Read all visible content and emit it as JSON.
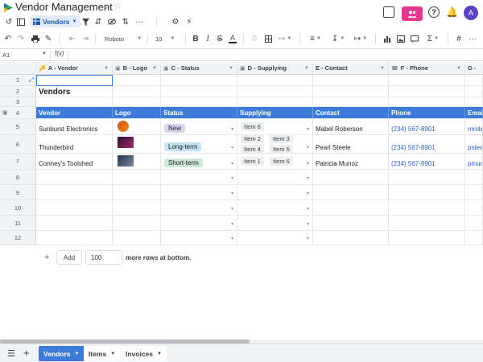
{
  "app": {
    "title": "Vendor Management",
    "avatar_letter": "A",
    "share_color": "#e2388e",
    "accent": "#3d7bd9"
  },
  "view": {
    "label": "Vendors"
  },
  "toolbar": {
    "font": "Roboto",
    "font_size": "10"
  },
  "formula": {
    "cell_ref": "A1",
    "fx_label": "f(x)"
  },
  "columns": [
    {
      "letter_label": "A - Vendor",
      "icon": "key-icon"
    },
    {
      "letter_label": "B - Logo",
      "icon": "image-icon"
    },
    {
      "letter_label": "C - Status",
      "icon": "dropdown-icon"
    },
    {
      "letter_label": "D - Supplying",
      "icon": "dropdown-icon"
    },
    {
      "letter_label": "E - Contact",
      "icon": ""
    },
    {
      "letter_label": "F - Phone",
      "icon": "phone-icon"
    },
    {
      "letter_label": "G -",
      "icon": ""
    }
  ],
  "rows": [
    "1",
    "2",
    "3",
    "4",
    "5",
    "6",
    "7",
    "8",
    "9",
    "10",
    "11",
    "12"
  ],
  "table_title": "Vendors",
  "table_headers": [
    "Vendor",
    "Logo",
    "Status",
    "Supplying",
    "Contact",
    "Phone",
    "Email"
  ],
  "vendors": [
    {
      "vendor": "Sunburst Electronics",
      "status": "New",
      "supplying": [
        "Item 6"
      ],
      "contact": "Mabel Roberson",
      "phone": "(234) 567-8901",
      "email": "mrobe"
    },
    {
      "vendor": "Thunderbird",
      "status": "Long-term",
      "supplying": [
        "Item 2",
        "Item 3",
        "Item 4",
        "Item 5"
      ],
      "contact": "Pearl Steele",
      "phone": "(234) 567-8901",
      "email": "psteel"
    },
    {
      "vendor": "Conney's Toolshed",
      "status": "Short-term",
      "supplying": [
        "Item 1",
        "Item 6"
      ],
      "contact": "Patricia Munoz",
      "phone": "(234) 567-8901",
      "email": "pmun"
    }
  ],
  "add_rows": {
    "button": "Add",
    "count": "100",
    "suffix": "more rows at bottom."
  },
  "tabs": [
    {
      "label": "Vendors",
      "active": true
    },
    {
      "label": "Items",
      "active": false
    },
    {
      "label": "Invoices",
      "active": false
    }
  ]
}
